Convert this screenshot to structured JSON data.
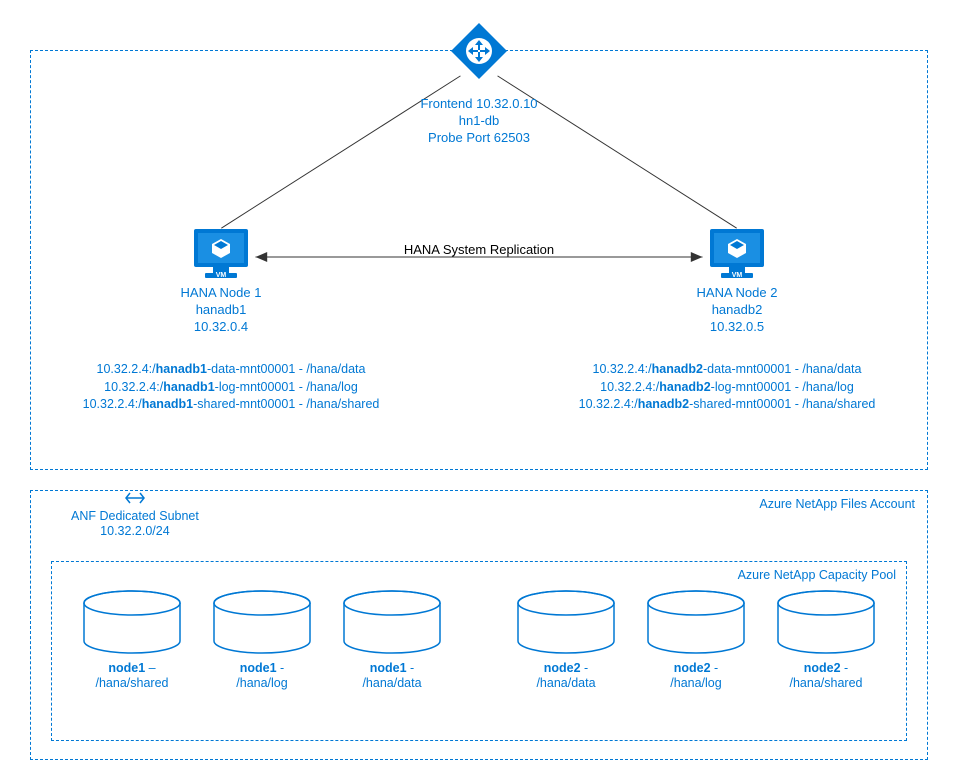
{
  "loadbalancer": {
    "frontend_ip": "Frontend 10.32.0.10",
    "name": "hn1-db",
    "probe": "Probe Port 62503"
  },
  "replication_label": "HANA System Replication",
  "nodes": {
    "n1": {
      "title": "HANA Node 1",
      "hostname": "hanadb1",
      "ip": "10.32.0.4",
      "mounts": {
        "data_prefix": "10.32.2.4:/",
        "host": "hanadb1",
        "data_suffix": "-data-mnt00001 - /hana/data",
        "log_prefix": "10.32.2.4:/",
        "log_suffix": "-log-mnt00001 - /hana/log",
        "shared_prefix": "10.32.2.4:/",
        "shared_suffix": "-shared-mnt00001 - /hana/shared"
      }
    },
    "n2": {
      "title": "HANA Node 2",
      "hostname": "hanadb2",
      "ip": "10.32.0.5",
      "mounts": {
        "data_prefix": "10.32.2.4:/",
        "host": "hanadb2",
        "data_suffix": "-data-mnt00001 - /hana/data",
        "log_prefix": "10.32.2.4:/",
        "log_suffix": "-log-mnt00001 - /hana/log",
        "shared_prefix": "10.32.2.4:/",
        "shared_suffix": "-shared-mnt00001 - /hana/shared"
      }
    }
  },
  "anf": {
    "subnet_label": "ANF Dedicated Subnet",
    "subnet_cidr": "10.32.2.0/24",
    "account_label": "Azure NetApp Files Account",
    "pool_label": "Azure NetApp Capacity Pool",
    "disks": {
      "left": [
        {
          "name": "node1",
          "sep": " – ",
          "path": "/hana/shared"
        },
        {
          "name": "node1",
          "sep": " - ",
          "path": "/hana/log"
        },
        {
          "name": "node1",
          "sep": " - ",
          "path": "/hana/data"
        }
      ],
      "right": [
        {
          "name": "node2",
          "sep": " - ",
          "path": "/hana/data"
        },
        {
          "name": "node2",
          "sep": " - ",
          "path": "/hana/log"
        },
        {
          "name": "node2",
          "sep": " - ",
          "path": "/hana/shared"
        }
      ]
    }
  }
}
